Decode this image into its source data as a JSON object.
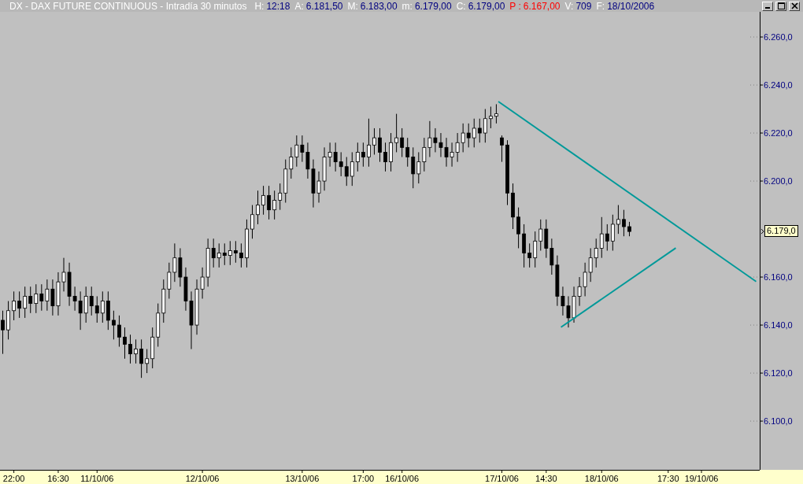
{
  "window": {
    "title": "DX - DAX FUTURE CONTINUOUS - Intradía 30 minutos"
  },
  "quote_fields": [
    {
      "label": "H:",
      "value": "12:18",
      "color": "#000080",
      "highlighted": false
    },
    {
      "label": "A:",
      "value": "6.181,50",
      "color": "#000080",
      "highlighted": false
    },
    {
      "label": "M:",
      "value": "6.183,00",
      "color": "#000080",
      "highlighted": false
    },
    {
      "label": "m:",
      "value": "6.179,00",
      "color": "#000080",
      "highlighted": false
    },
    {
      "label": "C:",
      "value": "6.179,00",
      "color": "#000080",
      "highlighted": false
    },
    {
      "label": "P :",
      "value": "6.167,00",
      "color": "#ff0000",
      "highlighted": true
    },
    {
      "label": "V:",
      "value": "709",
      "color": "#000080",
      "highlighted": false
    },
    {
      "label": "F:",
      "value": "18/10/2006",
      "color": "#000080",
      "highlighted": false
    }
  ],
  "last_price_tag": "6.179,0",
  "chart_data": {
    "type": "candlestick",
    "ylim": [
      6079.7,
      6270.5
    ],
    "yticks": [
      {
        "value": 6100,
        "label": "6.100,0"
      },
      {
        "value": 6120,
        "label": "6.120,0"
      },
      {
        "value": 6140,
        "label": "6.140,0"
      },
      {
        "value": 6160,
        "label": "6.160,0"
      },
      {
        "value": 6200,
        "label": "6.200,0"
      },
      {
        "value": 6220,
        "label": "6.220,0"
      },
      {
        "value": 6240,
        "label": "6.240,0"
      },
      {
        "value": 6260,
        "label": "6.260,0"
      }
    ],
    "categories": [
      null,
      null,
      "22:00",
      null,
      null,
      null,
      null,
      null,
      null,
      null,
      "16:30",
      null,
      null,
      null,
      null,
      null,
      null,
      "11/10/06",
      null,
      null,
      null,
      null,
      null,
      null,
      null,
      null,
      null,
      null,
      null,
      null,
      null,
      null,
      null,
      null,
      null,
      null,
      "12/10/06",
      null,
      null,
      null,
      null,
      null,
      null,
      null,
      null,
      null,
      null,
      null,
      null,
      null,
      null,
      null,
      null,
      null,
      "13/10/06",
      null,
      null,
      null,
      null,
      null,
      null,
      null,
      null,
      null,
      null,
      "17:00",
      null,
      null,
      null,
      null,
      null,
      null,
      "16/10/06",
      null,
      null,
      null,
      null,
      null,
      null,
      null,
      null,
      null,
      null,
      null,
      null,
      null,
      null,
      null,
      null,
      null,
      "17/10/06",
      null,
      null,
      null,
      null,
      null,
      null,
      null,
      "14:30",
      null,
      null,
      null,
      null,
      null,
      null,
      null,
      null,
      null,
      "18/10/06",
      null,
      null,
      null,
      null,
      null,
      null,
      null,
      null,
      null,
      null,
      null,
      "17:30",
      null,
      null,
      null,
      null,
      null,
      "19/10/06",
      null,
      null,
      null,
      null,
      null,
      null,
      null,
      null,
      null,
      null
    ],
    "ohlc": [
      [
        6142,
        6146,
        6128,
        6138
      ],
      [
        6138,
        6150,
        6134,
        6146
      ],
      [
        6146,
        6154,
        6142,
        6150
      ],
      [
        6150,
        6154,
        6143,
        6147
      ],
      [
        6147,
        6156,
        6143,
        6152
      ],
      [
        6152,
        6156,
        6145,
        6149
      ],
      [
        6149,
        6157,
        6145,
        6153
      ],
      [
        6153,
        6157,
        6146,
        6150
      ],
      [
        6150,
        6159,
        6146,
        6155
      ],
      [
        6155,
        6159,
        6144,
        6148
      ],
      [
        6148,
        6162,
        6144,
        6158
      ],
      [
        6158,
        6168,
        6154,
        6162
      ],
      [
        6162,
        6166,
        6148,
        6152
      ],
      [
        6152,
        6156,
        6146,
        6150
      ],
      [
        6150,
        6154,
        6138,
        6145
      ],
      [
        6145,
        6156,
        6141,
        6152
      ],
      [
        6152,
        6156,
        6144,
        6148
      ],
      [
        6148,
        6152,
        6141,
        6145
      ],
      [
        6145,
        6154,
        6141,
        6150
      ],
      [
        6150,
        6154,
        6138,
        6142
      ],
      [
        6142,
        6146,
        6134,
        6140
      ],
      [
        6140,
        6144,
        6131,
        6135
      ],
      [
        6135,
        6139,
        6126,
        6132
      ],
      [
        6132,
        6136,
        6124,
        6128
      ],
      [
        6128,
        6134,
        6124,
        6130
      ],
      [
        6130,
        6134,
        6118,
        6124
      ],
      [
        6124,
        6130,
        6120,
        6126
      ],
      [
        6126,
        6139,
        6122,
        6135
      ],
      [
        6135,
        6149,
        6131,
        6145
      ],
      [
        6145,
        6159,
        6141,
        6155
      ],
      [
        6155,
        6166,
        6151,
        6162
      ],
      [
        6162,
        6174,
        6158,
        6168
      ],
      [
        6168,
        6172,
        6156,
        6160
      ],
      [
        6160,
        6164,
        6146,
        6150
      ],
      [
        6150,
        6154,
        6130,
        6140
      ],
      [
        6140,
        6159,
        6136,
        6155
      ],
      [
        6155,
        6164,
        6151,
        6160
      ],
      [
        6160,
        6176,
        6156,
        6172
      ],
      [
        6172,
        6176,
        6164,
        6168
      ],
      [
        6168,
        6174,
        6164,
        6170
      ],
      [
        6170,
        6174,
        6165,
        6169
      ],
      [
        6169,
        6175,
        6165,
        6171
      ],
      [
        6171,
        6175,
        6166,
        6170
      ],
      [
        6170,
        6174,
        6164,
        6168
      ],
      [
        6168,
        6184,
        6164,
        6180
      ],
      [
        6180,
        6190,
        6176,
        6186
      ],
      [
        6186,
        6196,
        6182,
        6190
      ],
      [
        6190,
        6198,
        6186,
        6194
      ],
      [
        6194,
        6198,
        6184,
        6188
      ],
      [
        6188,
        6196,
        6184,
        6192
      ],
      [
        6192,
        6199,
        6188,
        6195
      ],
      [
        6195,
        6209,
        6191,
        6205
      ],
      [
        6205,
        6214,
        6201,
        6210
      ],
      [
        6210,
        6219,
        6206,
        6215
      ],
      [
        6215,
        6219,
        6208,
        6212
      ],
      [
        6212,
        6216,
        6201,
        6205
      ],
      [
        6205,
        6209,
        6189,
        6195
      ],
      [
        6195,
        6204,
        6191,
        6200
      ],
      [
        6200,
        6214,
        6196,
        6210
      ],
      [
        6210,
        6216,
        6206,
        6212
      ],
      [
        6212,
        6216,
        6204,
        6208
      ],
      [
        6208,
        6212,
        6202,
        6206
      ],
      [
        6206,
        6210,
        6198,
        6202
      ],
      [
        6202,
        6212,
        6198,
        6208
      ],
      [
        6208,
        6216,
        6204,
        6212
      ],
      [
        6212,
        6216,
        6206,
        6210
      ],
      [
        6210,
        6226,
        6206,
        6215
      ],
      [
        6215,
        6222,
        6211,
        6218
      ],
      [
        6218,
        6222,
        6208,
        6212
      ],
      [
        6212,
        6216,
        6204,
        6208
      ],
      [
        6208,
        6220,
        6204,
        6216
      ],
      [
        6216,
        6228,
        6212,
        6218
      ],
      [
        6218,
        6222,
        6210,
        6214
      ],
      [
        6214,
        6218,
        6206,
        6210
      ],
      [
        6210,
        6214,
        6197,
        6203
      ],
      [
        6203,
        6212,
        6199,
        6208
      ],
      [
        6208,
        6218,
        6204,
        6214
      ],
      [
        6214,
        6225,
        6210,
        6218
      ],
      [
        6218,
        6222,
        6212,
        6216
      ],
      [
        6216,
        6220,
        6210,
        6214
      ],
      [
        6214,
        6218,
        6206,
        6210
      ],
      [
        6210,
        6216,
        6206,
        6212
      ],
      [
        6212,
        6220,
        6208,
        6216
      ],
      [
        6216,
        6224,
        6212,
        6220
      ],
      [
        6220,
        6224,
        6214,
        6218
      ],
      [
        6218,
        6226,
        6214,
        6222
      ],
      [
        6222,
        6226,
        6216,
        6220
      ],
      [
        6220,
        6230,
        6216,
        6226
      ],
      [
        6226,
        6231,
        6222,
        6227
      ],
      [
        6227,
        6232,
        6224,
        6228
      ],
      [
        6218,
        6219,
        6208,
        6215
      ],
      [
        6215,
        6217,
        6190,
        6195
      ],
      [
        6195,
        6199,
        6180,
        6185
      ],
      [
        6185,
        6189,
        6172,
        6178
      ],
      [
        6178,
        6182,
        6164,
        6170
      ],
      [
        6170,
        6174,
        6164,
        6168
      ],
      [
        6168,
        6179,
        6164,
        6175
      ],
      [
        6175,
        6184,
        6171,
        6180
      ],
      [
        6180,
        6184,
        6168,
        6172
      ],
      [
        6172,
        6176,
        6161,
        6165
      ],
      [
        6165,
        6169,
        6148,
        6152
      ],
      [
        6152,
        6156,
        6144,
        6148
      ],
      [
        6148,
        6152,
        6139,
        6143
      ],
      [
        6143,
        6156,
        6141,
        6152
      ],
      [
        6152,
        6160,
        6148,
        6156
      ],
      [
        6156,
        6166,
        6152,
        6162
      ],
      [
        6162,
        6172,
        6158,
        6168
      ],
      [
        6168,
        6176,
        6164,
        6172
      ],
      [
        6172,
        6185,
        6168,
        6178
      ],
      [
        6178,
        6182,
        6171,
        6175
      ],
      [
        6175,
        6186,
        6171,
        6182
      ],
      [
        6182,
        6190,
        6178,
        6184
      ],
      [
        6184,
        6188,
        6177,
        6181
      ],
      [
        6181,
        6183,
        6177,
        6179
      ],
      null,
      null,
      null,
      null,
      null,
      null,
      null,
      null,
      null,
      null,
      null,
      null,
      null,
      null,
      null,
      null,
      null,
      null,
      null,
      null,
      null,
      null,
      null
    ]
  }
}
